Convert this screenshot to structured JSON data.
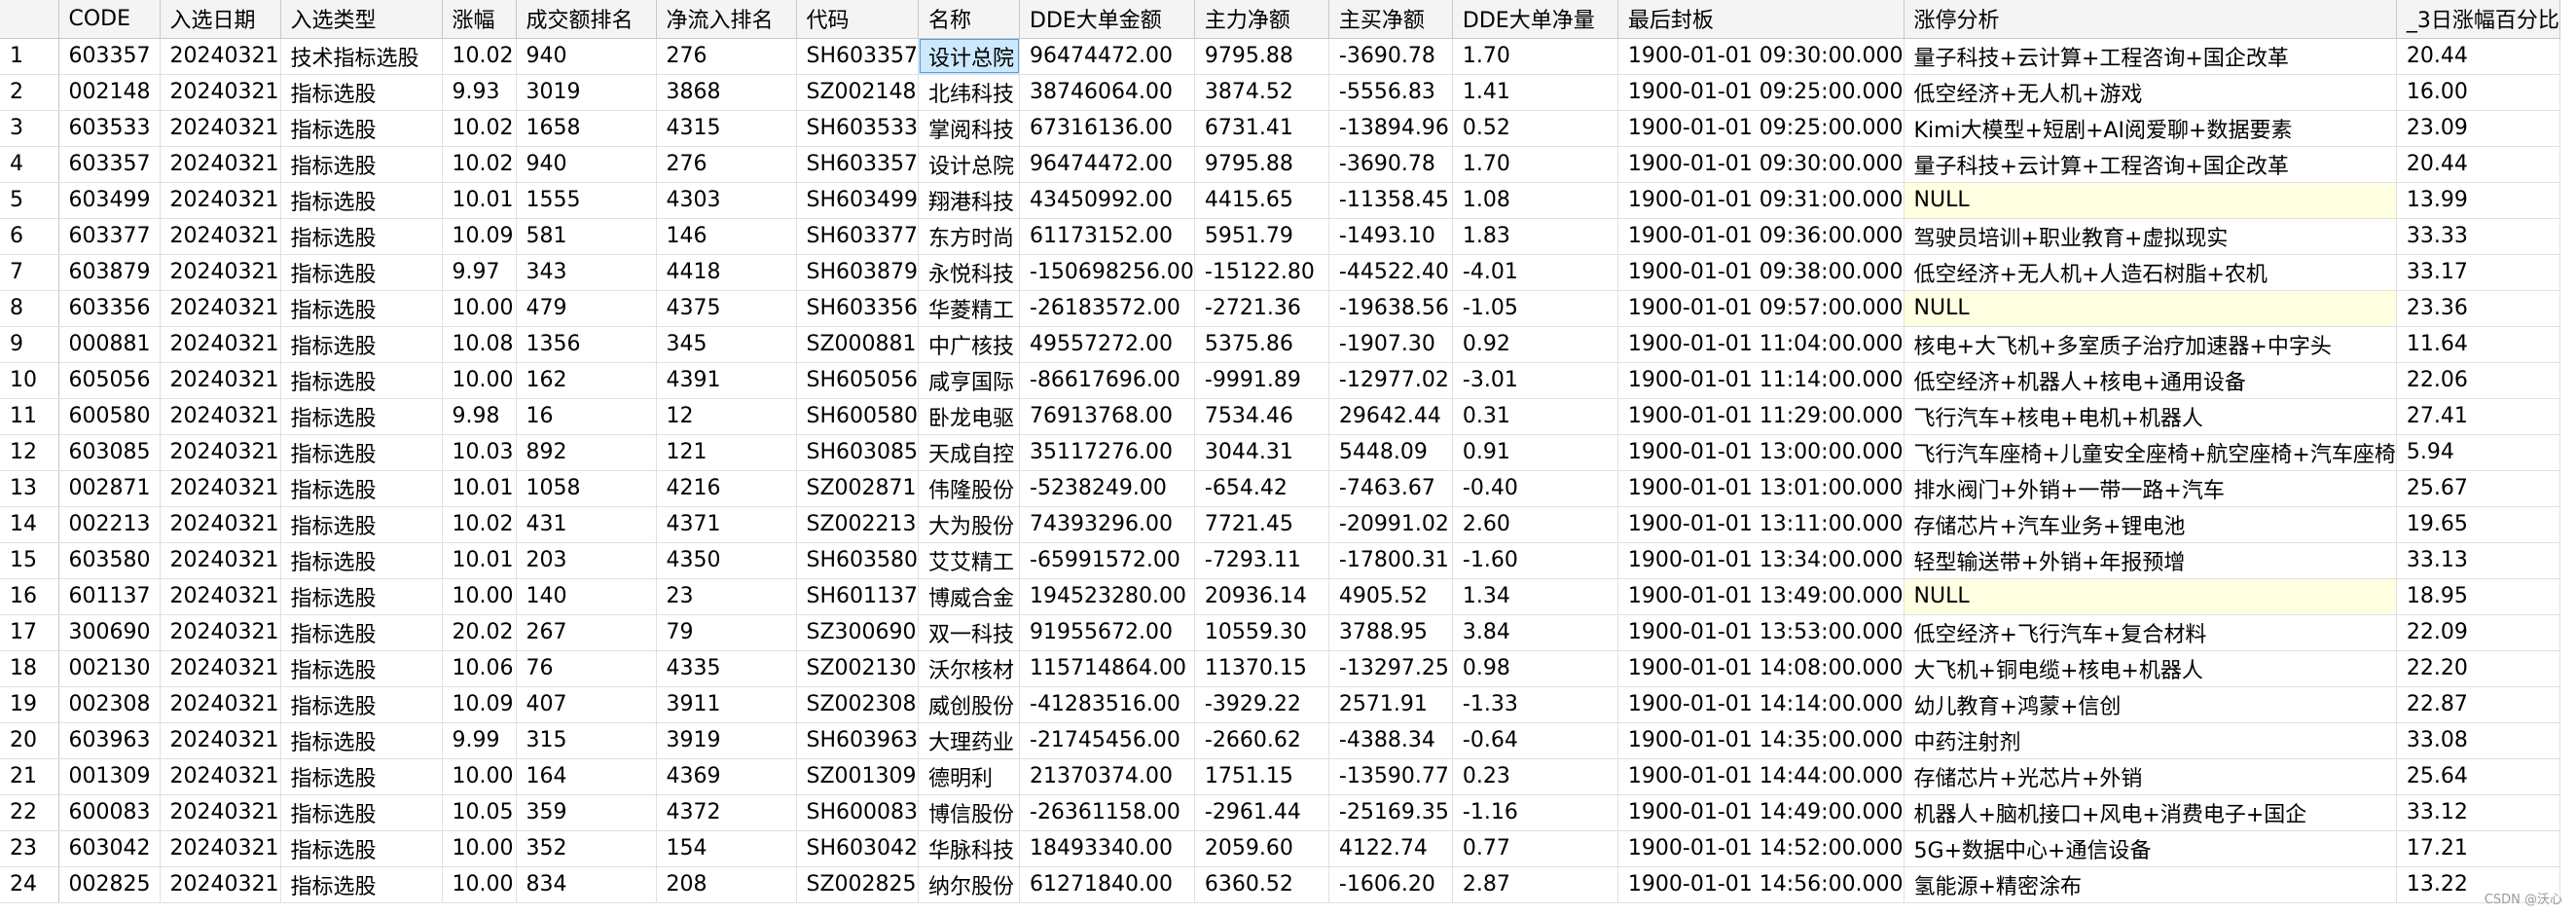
{
  "columns": [
    "CODE",
    "入选日期",
    "入选类型",
    "涨幅",
    "成交额排名",
    "净流入排名",
    "代码",
    "名称",
    "DDE大单金额",
    "主力净额",
    "主买净额",
    "DDE大单净量",
    "最后封板",
    "涨停分析",
    "_3日涨幅百分比"
  ],
  "selected_cell": {
    "row": 0,
    "col": 7
  },
  "rows": [
    {
      "n": "1",
      "c": [
        "603357",
        "20240321",
        "技术指标选股",
        "10.02",
        "940",
        "276",
        "SH603357",
        "设计总院",
        "96474472.00",
        "9795.88",
        "-3690.78",
        "1.70",
        "1900-01-01 09:30:00.000",
        "量子科技+云计算+工程咨询+国企改革",
        "20.44"
      ]
    },
    {
      "n": "2",
      "c": [
        "002148",
        "20240321",
        "指标选股",
        "9.93",
        "3019",
        "3868",
        "SZ002148",
        "北纬科技",
        "38746064.00",
        "3874.52",
        "-5556.83",
        "1.41",
        "1900-01-01 09:25:00.000",
        "低空经济+无人机+游戏",
        "16.00"
      ]
    },
    {
      "n": "3",
      "c": [
        "603533",
        "20240321",
        "指标选股",
        "10.02",
        "1658",
        "4315",
        "SH603533",
        "掌阅科技",
        "67316136.00",
        "6731.41",
        "-13894.96",
        "0.52",
        "1900-01-01 09:25:00.000",
        "Kimi大模型+短剧+AI阅爱聊+数据要素",
        "23.09"
      ]
    },
    {
      "n": "4",
      "c": [
        "603357",
        "20240321",
        "指标选股",
        "10.02",
        "940",
        "276",
        "SH603357",
        "设计总院",
        "96474472.00",
        "9795.88",
        "-3690.78",
        "1.70",
        "1900-01-01 09:30:00.000",
        "量子科技+云计算+工程咨询+国企改革",
        "20.44"
      ]
    },
    {
      "n": "5",
      "c": [
        "603499",
        "20240321",
        "指标选股",
        "10.01",
        "1555",
        "4303",
        "SH603499",
        "翔港科技",
        "43450992.00",
        "4415.65",
        "-11358.45",
        "1.08",
        "1900-01-01 09:31:00.000",
        "NULL",
        "13.99"
      ]
    },
    {
      "n": "6",
      "c": [
        "603377",
        "20240321",
        "指标选股",
        "10.09",
        "581",
        "146",
        "SH603377",
        "东方时尚",
        "61173152.00",
        "5951.79",
        "-1493.10",
        "1.83",
        "1900-01-01 09:36:00.000",
        "驾驶员培训+职业教育+虚拟现实",
        "33.33"
      ]
    },
    {
      "n": "7",
      "c": [
        "603879",
        "20240321",
        "指标选股",
        "9.97",
        "343",
        "4418",
        "SH603879",
        "永悦科技",
        "-150698256.00",
        "-15122.80",
        "-44522.40",
        "-4.01",
        "1900-01-01 09:38:00.000",
        "低空经济+无人机+人造石树脂+农机",
        "33.17"
      ]
    },
    {
      "n": "8",
      "c": [
        "603356",
        "20240321",
        "指标选股",
        "10.00",
        "479",
        "4375",
        "SH603356",
        "华菱精工",
        "-26183572.00",
        "-2721.36",
        "-19638.56",
        "-1.05",
        "1900-01-01 09:57:00.000",
        "NULL",
        "23.36"
      ]
    },
    {
      "n": "9",
      "c": [
        "000881",
        "20240321",
        "指标选股",
        "10.08",
        "1356",
        "345",
        "SZ000881",
        "中广核技",
        "49557272.00",
        "5375.86",
        "-1907.30",
        "0.92",
        "1900-01-01 11:04:00.000",
        "核电+大飞机+多室质子治疗加速器+中字头",
        "11.64"
      ]
    },
    {
      "n": "10",
      "c": [
        "605056",
        "20240321",
        "指标选股",
        "10.00",
        "162",
        "4391",
        "SH605056",
        "咸亨国际",
        "-86617696.00",
        "-9991.89",
        "-12977.02",
        "-3.01",
        "1900-01-01 11:14:00.000",
        "低空经济+机器人+核电+通用设备",
        "22.06"
      ]
    },
    {
      "n": "11",
      "c": [
        "600580",
        "20240321",
        "指标选股",
        "9.98",
        "16",
        "12",
        "SH600580",
        "卧龙电驱",
        "76913768.00",
        "7534.46",
        "29642.44",
        "0.31",
        "1900-01-01 11:29:00.000",
        "飞行汽车+核电+电机+机器人",
        "27.41"
      ]
    },
    {
      "n": "12",
      "c": [
        "603085",
        "20240321",
        "指标选股",
        "10.03",
        "892",
        "121",
        "SH603085",
        "天成自控",
        "35117276.00",
        "3044.31",
        "5448.09",
        "0.91",
        "1900-01-01 13:00:00.000",
        "飞行汽车座椅+儿童安全座椅+航空座椅+汽车座椅",
        "5.94"
      ]
    },
    {
      "n": "13",
      "c": [
        "002871",
        "20240321",
        "指标选股",
        "10.01",
        "1058",
        "4216",
        "SZ002871",
        "伟隆股份",
        "-5238249.00",
        "-654.42",
        "-7463.67",
        "-0.40",
        "1900-01-01 13:01:00.000",
        "排水阀门+外销+一带一路+汽车",
        "25.67"
      ]
    },
    {
      "n": "14",
      "c": [
        "002213",
        "20240321",
        "指标选股",
        "10.02",
        "431",
        "4371",
        "SZ002213",
        "大为股份",
        "74393296.00",
        "7721.45",
        "-20991.02",
        "2.60",
        "1900-01-01 13:11:00.000",
        "存储芯片+汽车业务+锂电池",
        "19.65"
      ]
    },
    {
      "n": "15",
      "c": [
        "603580",
        "20240321",
        "指标选股",
        "10.01",
        "203",
        "4350",
        "SH603580",
        "艾艾精工",
        "-65991572.00",
        "-7293.11",
        "-17800.31",
        "-1.60",
        "1900-01-01 13:34:00.000",
        "轻型输送带+外销+年报预增",
        "33.13"
      ]
    },
    {
      "n": "16",
      "c": [
        "601137",
        "20240321",
        "指标选股",
        "10.00",
        "140",
        "23",
        "SH601137",
        "博威合金",
        "194523280.00",
        "20936.14",
        "4905.52",
        "1.34",
        "1900-01-01 13:49:00.000",
        "NULL",
        "18.95"
      ]
    },
    {
      "n": "17",
      "c": [
        "300690",
        "20240321",
        "指标选股",
        "20.02",
        "267",
        "79",
        "SZ300690",
        "双一科技",
        "91955672.00",
        "10559.30",
        "3788.95",
        "3.84",
        "1900-01-01 13:53:00.000",
        "低空经济+飞行汽车+复合材料",
        "22.09"
      ]
    },
    {
      "n": "18",
      "c": [
        "002130",
        "20240321",
        "指标选股",
        "10.06",
        "76",
        "4335",
        "SZ002130",
        "沃尔核材",
        "115714864.00",
        "11370.15",
        "-13297.25",
        "0.98",
        "1900-01-01 14:08:00.000",
        "大飞机+铜电缆+核电+机器人",
        "22.20"
      ]
    },
    {
      "n": "19",
      "c": [
        "002308",
        "20240321",
        "指标选股",
        "10.09",
        "407",
        "3911",
        "SZ002308",
        "威创股份",
        "-41283516.00",
        "-3929.22",
        "2571.91",
        "-1.33",
        "1900-01-01 14:14:00.000",
        "幼儿教育+鸿蒙+信创",
        "22.87"
      ]
    },
    {
      "n": "20",
      "c": [
        "603963",
        "20240321",
        "指标选股",
        "9.99",
        "315",
        "3919",
        "SH603963",
        "大理药业",
        "-21745456.00",
        "-2660.62",
        "-4388.34",
        "-0.64",
        "1900-01-01 14:35:00.000",
        "中药注射剂",
        "33.08"
      ]
    },
    {
      "n": "21",
      "c": [
        "001309",
        "20240321",
        "指标选股",
        "10.00",
        "164",
        "4369",
        "SZ001309",
        "德明利",
        "21370374.00",
        "1751.15",
        "-13590.77",
        "0.23",
        "1900-01-01 14:44:00.000",
        "存储芯片+光芯片+外销",
        "25.64"
      ]
    },
    {
      "n": "22",
      "c": [
        "600083",
        "20240321",
        "指标选股",
        "10.05",
        "359",
        "4372",
        "SH600083",
        "博信股份",
        "-26361158.00",
        "-2961.44",
        "-25169.35",
        "-1.16",
        "1900-01-01 14:49:00.000",
        "机器人+脑机接口+风电+消费电子+国企",
        "33.12"
      ]
    },
    {
      "n": "23",
      "c": [
        "603042",
        "20240321",
        "指标选股",
        "10.00",
        "352",
        "154",
        "SH603042",
        "华脉科技",
        "18493340.00",
        "2059.60",
        "4122.74",
        "0.77",
        "1900-01-01 14:52:00.000",
        "5G+数据中心+通信设备",
        "17.21"
      ]
    },
    {
      "n": "24",
      "c": [
        "002825",
        "20240321",
        "指标选股",
        "10.00",
        "834",
        "208",
        "SZ002825",
        "纳尔股份",
        "61271840.00",
        "6360.52",
        "-1606.20",
        "2.87",
        "1900-01-01 14:56:00.000",
        "氢能源+精密涂布",
        "13.22"
      ]
    }
  ],
  "watermark": "CSDN @沃心"
}
